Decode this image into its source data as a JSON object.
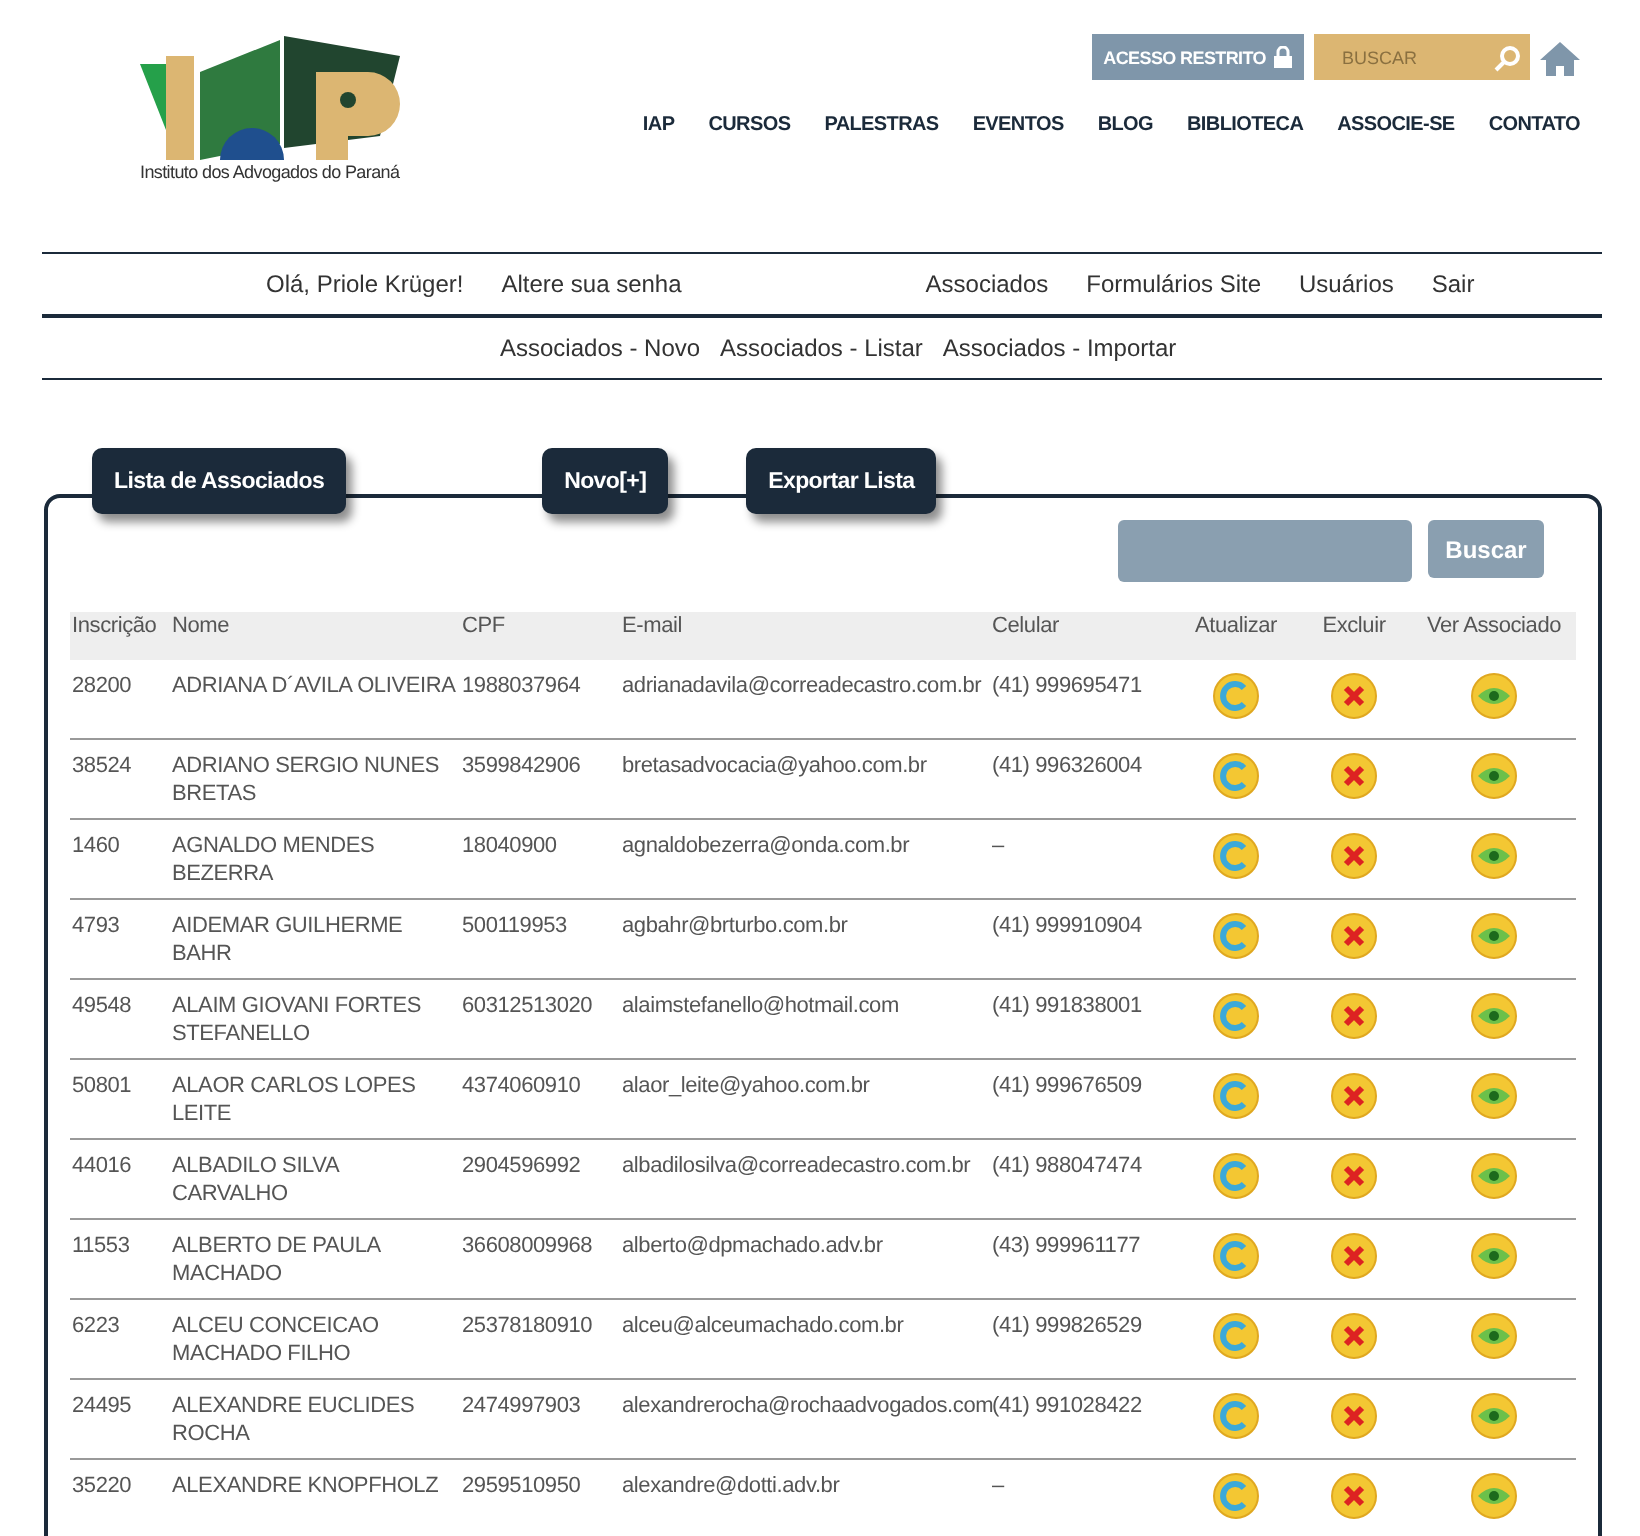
{
  "logo": {
    "caption": "Instituto dos Advogados do Paraná"
  },
  "header": {
    "restricted_button": "ACESSO RESTRITO",
    "search": {
      "placeholder": "BUSCAR"
    }
  },
  "main_nav": [
    "IAP",
    "CURSOS",
    "PALESTRAS",
    "EVENTOS",
    "BLOG",
    "BIBLIOTECA",
    "ASSOCIE-SE",
    "CONTATO"
  ],
  "user_bar": {
    "greeting": "Olá, Priole Krüger!",
    "change_password": "Altere sua senha",
    "links": [
      "Associados",
      "Formulários Site",
      "Usuários",
      "Sair"
    ]
  },
  "sub_nav": [
    "Associados - Novo",
    "Associados - Listar",
    "Associados - Importar"
  ],
  "tabs": [
    "Lista de Associados",
    "Novo[+]",
    "Exportar Lista"
  ],
  "search": {
    "button": "Buscar"
  },
  "table": {
    "columns": [
      "Inscrição",
      "Nome",
      "CPF",
      "E-mail",
      "Celular",
      "Atualizar",
      "Excluir",
      "Ver Associado"
    ],
    "rows": [
      {
        "inscricao": "28200",
        "nome": "ADRIANA D´AVILA OLIVEIRA",
        "cpf": "1988037964",
        "email": "adrianadavila@correadecastro.com.br",
        "celular": "(41) 999695471"
      },
      {
        "inscricao": "38524",
        "nome": "ADRIANO SERGIO NUNES BRETAS",
        "cpf": "3599842906",
        "email": "bretasadvocacia@yahoo.com.br",
        "celular": "(41) 996326004"
      },
      {
        "inscricao": "1460",
        "nome": "AGNALDO MENDES BEZERRA",
        "cpf": "18040900",
        "email": "agnaldobezerra@onda.com.br",
        "celular": "–"
      },
      {
        "inscricao": "4793",
        "nome": "AIDEMAR GUILHERME BAHR",
        "cpf": "500119953",
        "email": "agbahr@brturbo.com.br",
        "celular": "(41) 999910904"
      },
      {
        "inscricao": "49548",
        "nome": "ALAIM GIOVANI FORTES STEFANELLO",
        "cpf": "60312513020",
        "email": "alaimstefanello@hotmail.com",
        "celular": "(41) 991838001"
      },
      {
        "inscricao": "50801",
        "nome": "ALAOR CARLOS LOPES LEITE",
        "cpf": "4374060910",
        "email": "alaor_leite@yahoo.com.br",
        "celular": "(41) 999676509"
      },
      {
        "inscricao": "44016",
        "nome": "ALBADILO SILVA CARVALHO",
        "cpf": "2904596992",
        "email": "albadilosilva@correadecastro.com.br",
        "celular": "(41) 988047474"
      },
      {
        "inscricao": "11553",
        "nome": "ALBERTO DE PAULA MACHADO",
        "cpf": "36608009968",
        "email": "alberto@dpmachado.adv.br",
        "celular": "(43) 999961177"
      },
      {
        "inscricao": "6223",
        "nome": "ALCEU CONCEICAO MACHADO FILHO",
        "cpf": "25378180910",
        "email": "alceu@alceumachado.com.br",
        "celular": "(41) 999826529"
      },
      {
        "inscricao": "24495",
        "nome": "ALEXANDRE EUCLIDES ROCHA",
        "cpf": "2474997903",
        "email": "alexandrerocha@rochaadvogados.com",
        "celular": "(41) 991028422"
      },
      {
        "inscricao": "35220",
        "nome": "ALEXANDRE KNOPFHOLZ",
        "cpf": "2959510950",
        "email": "alexandre@dotti.adv.br",
        "celular": "–"
      }
    ]
  }
}
